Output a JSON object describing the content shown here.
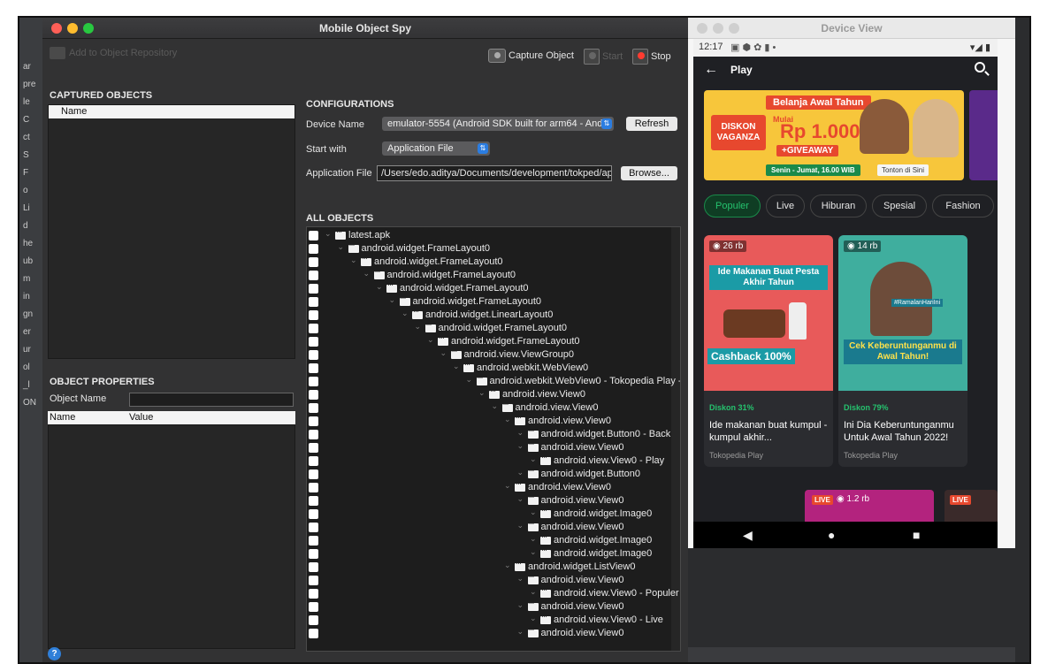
{
  "spy": {
    "title": "Mobile Object Spy",
    "add_repo": "Add to Object Repository",
    "captured_title": "CAPTURED OBJECTS",
    "captured_col": "Name",
    "props_title": "OBJECT PROPERTIES",
    "object_name_label": "Object Name",
    "props_cols": [
      "Name",
      "Value"
    ],
    "toolbar": {
      "capture": "Capture Object",
      "start": "Start",
      "stop": "Stop"
    },
    "config": {
      "title": "CONFIGURATIONS",
      "device_label": "Device Name",
      "device_value": "emulator-5554 (Android SDK built for arm64 - And",
      "refresh": "Refresh",
      "start_label": "Start with",
      "start_value": "Application File",
      "app_file_label": "Application File",
      "app_file_value": "/Users/edo.aditya/Documents/development/tokped/ap",
      "browse": "Browse..."
    },
    "all_objects_title": "ALL OBJECTS",
    "tree": [
      {
        "label": "latest.apk",
        "depth": 0
      },
      {
        "label": "android.widget.FrameLayout0",
        "depth": 1
      },
      {
        "label": "android.widget.FrameLayout0",
        "depth": 2
      },
      {
        "label": "android.widget.FrameLayout0",
        "depth": 3
      },
      {
        "label": "android.widget.FrameLayout0",
        "depth": 4
      },
      {
        "label": "android.widget.FrameLayout0",
        "depth": 5
      },
      {
        "label": "android.widget.LinearLayout0",
        "depth": 6
      },
      {
        "label": "android.widget.FrameLayout0",
        "depth": 7
      },
      {
        "label": "android.widget.FrameLayout0",
        "depth": 8
      },
      {
        "label": "android.view.ViewGroup0",
        "depth": 9
      },
      {
        "label": "android.webkit.WebView0",
        "depth": 10
      },
      {
        "label": "android.webkit.WebView0 - Tokopedia Play -",
        "depth": 11
      },
      {
        "label": "android.view.View0",
        "depth": 12
      },
      {
        "label": "android.view.View0",
        "depth": 13
      },
      {
        "label": "android.view.View0",
        "depth": 14
      },
      {
        "label": "android.widget.Button0 - Back",
        "depth": 15
      },
      {
        "label": "android.view.View0",
        "depth": 15
      },
      {
        "label": "android.view.View0 - Play",
        "depth": 16
      },
      {
        "label": "android.widget.Button0",
        "depth": 15
      },
      {
        "label": "android.view.View0",
        "depth": 14
      },
      {
        "label": "android.view.View0",
        "depth": 15
      },
      {
        "label": "android.widget.Image0",
        "depth": 16
      },
      {
        "label": "android.view.View0",
        "depth": 15
      },
      {
        "label": "android.widget.Image0",
        "depth": 16
      },
      {
        "label": "android.widget.Image0",
        "depth": 16
      },
      {
        "label": "android.widget.ListView0",
        "depth": 14
      },
      {
        "label": "android.view.View0",
        "depth": 15
      },
      {
        "label": "android.view.View0 - Populer",
        "depth": 16
      },
      {
        "label": "android.view.View0",
        "depth": 15
      },
      {
        "label": "android.view.View0 - Live",
        "depth": 16
      },
      {
        "label": "android.view.View0",
        "depth": 15
      }
    ]
  },
  "bg_strip": [
    "ar",
    "pre",
    "le",
    "C",
    "ct",
    "S",
    "F",
    "o",
    "Li",
    "d",
    "he",
    "ub",
    "m",
    "in",
    "gn",
    "er",
    "ur",
    "ol",
    "_l",
    "ON"
  ],
  "device": {
    "title": "Device View",
    "status_time": "12:17",
    "status_right": "▾◢ ▮",
    "app_title": "Play",
    "banner": {
      "header": "Belanja Awal Tahun",
      "diskon": "DISKON VAGANZA",
      "mulai": "Mulai",
      "price": "Rp 1.000*",
      "giveaway": "+GIVEAWAY",
      "schedule": "Senin - Jumat, 16.00 WIB",
      "watch": "Tonton di Sini"
    },
    "chips": [
      "Populer",
      "Live",
      "Hiburan",
      "Spesial",
      "Fashion"
    ],
    "cards": [
      {
        "views": "26 rb",
        "headline": "Ide Makanan Buat Pesta Akhir Tahun",
        "promo": "Cashback 100%",
        "discount": "Diskon 31%",
        "title": "Ide makanan buat kumpul - kumpul akhir...",
        "source": "Tokopedia Play"
      },
      {
        "views": "14 rb",
        "headline": "#RamalanHariIni",
        "promo": "Cek Keberuntunganmu di Awal Tahun!",
        "discount": "Diskon 79%",
        "title": "Ini Dia Keberuntunganmu Untuk Awal Tahun 2022!",
        "source": "Tokopedia Play"
      }
    ],
    "live_tag": "LIVE",
    "live_views": "1.2 rb",
    "live_tag2": "LIVE",
    "nav": [
      "◀",
      "●",
      "■"
    ]
  },
  "colors": {
    "accent_blue": "#2b7de1",
    "live_red": "#e7482e",
    "tokopedia_green": "#25c26e"
  }
}
